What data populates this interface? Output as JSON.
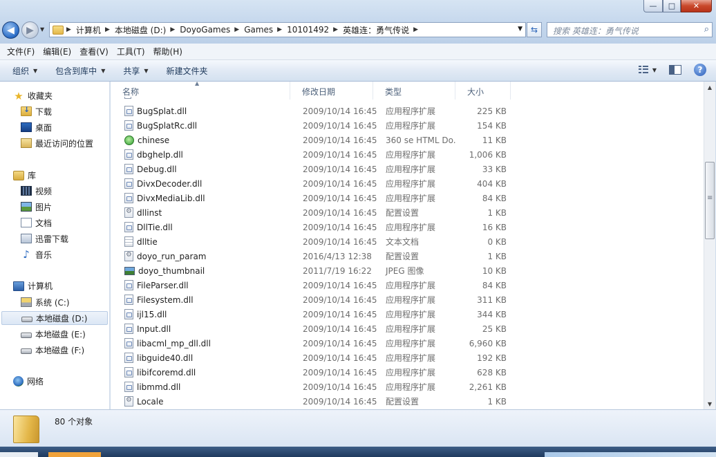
{
  "window": {
    "minimize_glyph": "—",
    "maximize_glyph": "□",
    "close_glyph": "✕"
  },
  "nav": {
    "back_glyph": "◀",
    "forward_glyph": "▶",
    "refresh_glyph": "⇆"
  },
  "breadcrumb": [
    "计算机",
    "本地磁盘 (D:)",
    "DoyoGames",
    "Games",
    "10101492",
    "英雄连：勇气传说"
  ],
  "search": {
    "placeholder": "搜索 英雄连：勇气传说",
    "icon": "search-icon"
  },
  "menu": [
    "文件(F)",
    "编辑(E)",
    "查看(V)",
    "工具(T)",
    "帮助(H)"
  ],
  "toolbar": {
    "organize": "组织",
    "include_in_library": "包含到库中",
    "share": "共享",
    "new_folder": "新建文件夹",
    "help_glyph": "?"
  },
  "sidebar": {
    "favorites": {
      "label": "收藏夹",
      "items": [
        "下载",
        "桌面",
        "最近访问的位置"
      ]
    },
    "libraries": {
      "label": "库",
      "items": [
        "视频",
        "图片",
        "文档",
        "迅雷下载",
        "音乐"
      ]
    },
    "computer": {
      "label": "计算机",
      "items": [
        "系统 (C:)",
        "本地磁盘 (D:)",
        "本地磁盘 (E:)",
        "本地磁盘 (F:)"
      ],
      "selected": "本地磁盘 (D:)"
    },
    "network": {
      "label": "网络"
    }
  },
  "columns": {
    "name": "名称",
    "modified": "修改日期",
    "type": "类型",
    "size": "大小"
  },
  "files": [
    {
      "name": "BugSplat.dll",
      "date": "2009/10/14 16:45",
      "type": "应用程序扩展",
      "size": "225 KB",
      "icon": "dll"
    },
    {
      "name": "BugSplatRc.dll",
      "date": "2009/10/14 16:45",
      "type": "应用程序扩展",
      "size": "154 KB",
      "icon": "dll"
    },
    {
      "name": "chinese",
      "date": "2009/10/14 16:45",
      "type": "360 se HTML Do...",
      "size": "11 KB",
      "icon": "html"
    },
    {
      "name": "dbghelp.dll",
      "date": "2009/10/14 16:45",
      "type": "应用程序扩展",
      "size": "1,006 KB",
      "icon": "dll"
    },
    {
      "name": "Debug.dll",
      "date": "2009/10/14 16:45",
      "type": "应用程序扩展",
      "size": "33 KB",
      "icon": "dll"
    },
    {
      "name": "DivxDecoder.dll",
      "date": "2009/10/14 16:45",
      "type": "应用程序扩展",
      "size": "404 KB",
      "icon": "dll"
    },
    {
      "name": "DivxMediaLib.dll",
      "date": "2009/10/14 16:45",
      "type": "应用程序扩展",
      "size": "84 KB",
      "icon": "dll"
    },
    {
      "name": "dllinst",
      "date": "2009/10/14 16:45",
      "type": "配置设置",
      "size": "1 KB",
      "icon": "cfg"
    },
    {
      "name": "DllTie.dll",
      "date": "2009/10/14 16:45",
      "type": "应用程序扩展",
      "size": "16 KB",
      "icon": "dll"
    },
    {
      "name": "dlltie",
      "date": "2009/10/14 16:45",
      "type": "文本文档",
      "size": "0 KB",
      "icon": "txt"
    },
    {
      "name": "doyo_run_param",
      "date": "2016/4/13 12:38",
      "type": "配置设置",
      "size": "1 KB",
      "icon": "cfg"
    },
    {
      "name": "doyo_thumbnail",
      "date": "2011/7/19 16:22",
      "type": "JPEG 图像",
      "size": "10 KB",
      "icon": "jpg"
    },
    {
      "name": "FileParser.dll",
      "date": "2009/10/14 16:45",
      "type": "应用程序扩展",
      "size": "84 KB",
      "icon": "dll"
    },
    {
      "name": "Filesystem.dll",
      "date": "2009/10/14 16:45",
      "type": "应用程序扩展",
      "size": "311 KB",
      "icon": "dll"
    },
    {
      "name": "ijl15.dll",
      "date": "2009/10/14 16:45",
      "type": "应用程序扩展",
      "size": "344 KB",
      "icon": "dll"
    },
    {
      "name": "Input.dll",
      "date": "2009/10/14 16:45",
      "type": "应用程序扩展",
      "size": "25 KB",
      "icon": "dll"
    },
    {
      "name": "libacml_mp_dll.dll",
      "date": "2009/10/14 16:45",
      "type": "应用程序扩展",
      "size": "6,960 KB",
      "icon": "dll"
    },
    {
      "name": "libguide40.dll",
      "date": "2009/10/14 16:45",
      "type": "应用程序扩展",
      "size": "192 KB",
      "icon": "dll"
    },
    {
      "name": "libifcoremd.dll",
      "date": "2009/10/14 16:45",
      "type": "应用程序扩展",
      "size": "628 KB",
      "icon": "dll"
    },
    {
      "name": "libmmd.dll",
      "date": "2009/10/14 16:45",
      "type": "应用程序扩展",
      "size": "2,261 KB",
      "icon": "dll"
    },
    {
      "name": "Locale",
      "date": "2009/10/14 16:45",
      "type": "配置设置",
      "size": "1 KB",
      "icon": "cfg"
    }
  ],
  "status": {
    "object_count": "80 个对象"
  }
}
